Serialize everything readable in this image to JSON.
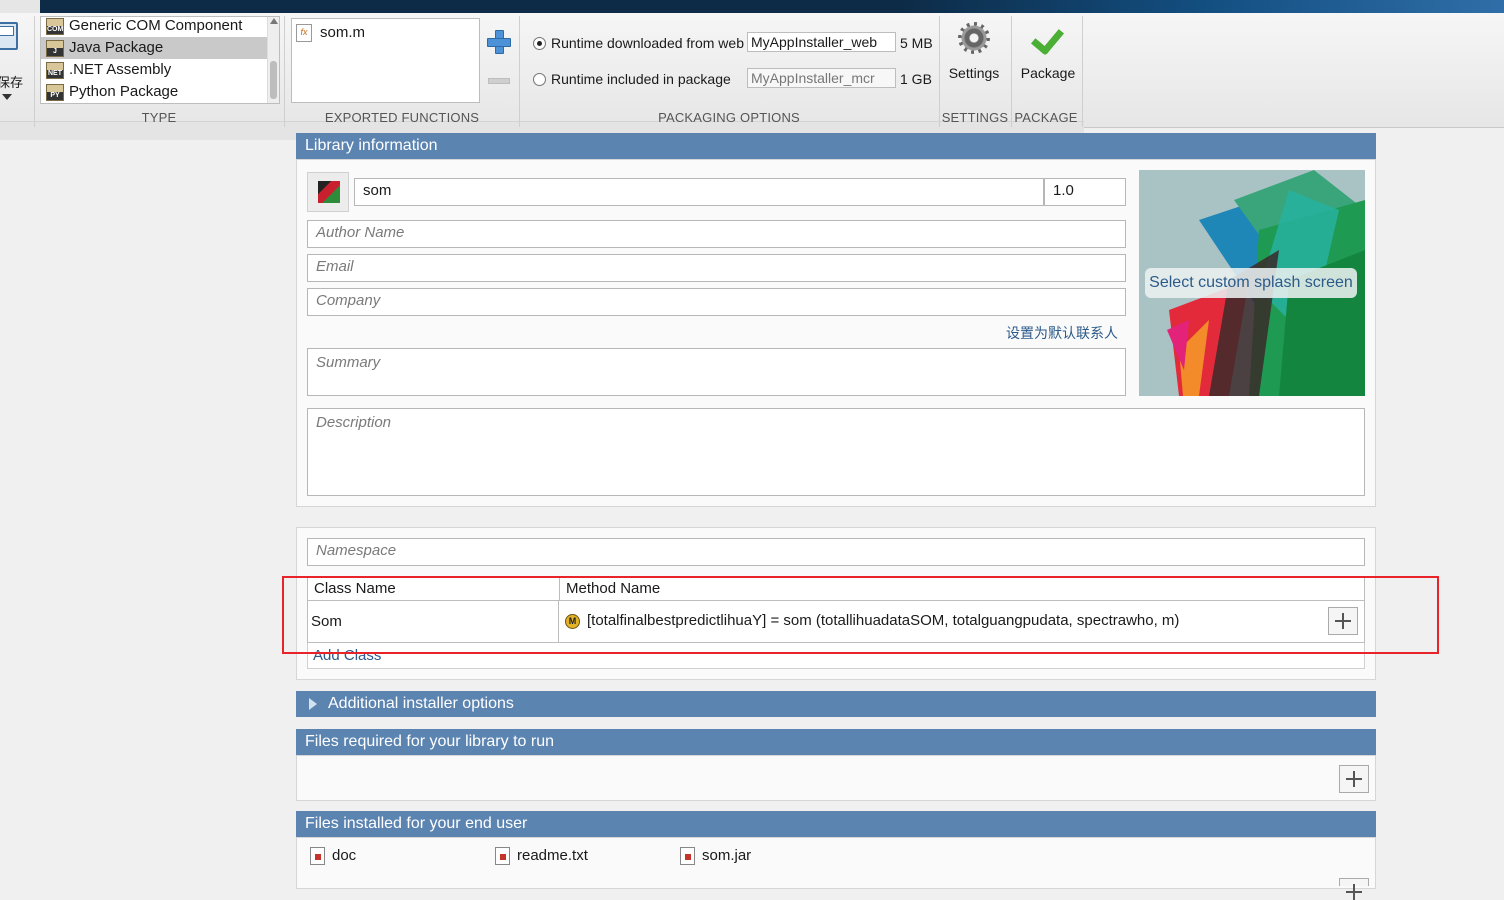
{
  "toolstrip": {
    "save_label": "保存",
    "type_section": "TYPE",
    "exported_section": "EXPORTED FUNCTIONS",
    "packaging_section": "PACKAGING OPTIONS",
    "settings_section": "SETTINGS",
    "package_section": "PACKAGE",
    "types": [
      {
        "label": "Generic COM Component",
        "icon": "COM",
        "selected": false
      },
      {
        "label": "Java Package",
        "icon": "J",
        "selected": true
      },
      {
        "label": ".NET Assembly",
        "icon": "NET",
        "selected": false
      },
      {
        "label": "Python Package",
        "icon": "PY",
        "selected": false
      }
    ],
    "exported_functions": [
      "som.m"
    ],
    "runtime_web_label": "Runtime downloaded from web",
    "runtime_web_value": "MyAppInstaller_web",
    "runtime_web_size": "5 MB",
    "runtime_pkg_label": "Runtime included in package",
    "runtime_pkg_value": "MyAppInstaller_mcr",
    "runtime_pkg_size": "1 GB",
    "settings_label": "Settings",
    "package_label": "Package"
  },
  "library_info": {
    "header": "Library information",
    "name": "som",
    "version": "1.0",
    "author_placeholder": "Author Name",
    "email_placeholder": "Email",
    "company_placeholder": "Company",
    "default_contact_link": "设置为默认联系人",
    "summary_placeholder": "Summary",
    "description_placeholder": "Description",
    "splash_button": "Select custom splash screen"
  },
  "class_section": {
    "namespace_placeholder": "Namespace",
    "class_name_header": "Class Name",
    "method_name_header": "Method Name",
    "class_name": "Som",
    "method": "[totalfinalbestpredictlihuaY] = som (totallihuadataSOM, totalguangpudata, spectrawho, m)",
    "method_icon": "M",
    "add_class": "Add Class"
  },
  "additional_options": {
    "header": "Additional installer options"
  },
  "files_required": {
    "header": "Files required for your library to run"
  },
  "files_installed": {
    "header": "Files installed for your end user",
    "files": [
      "doc",
      "readme.txt",
      "som.jar"
    ]
  },
  "colors": {
    "panel_header": "#5b84b1",
    "highlight": "#e8242a",
    "link": "#2c5b8a"
  }
}
